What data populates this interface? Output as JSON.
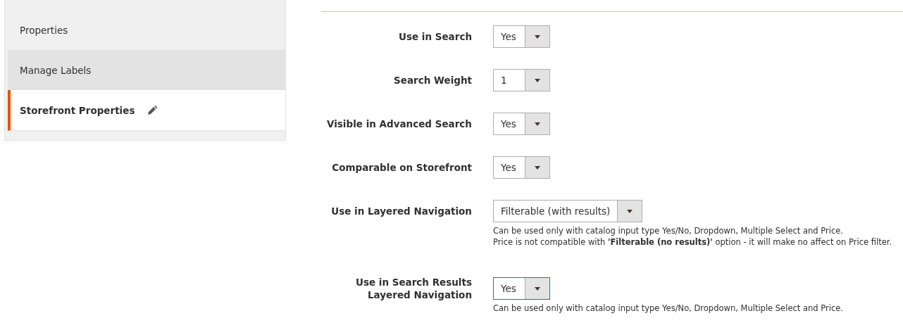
{
  "tabs": [
    {
      "label": "Properties",
      "selected": false,
      "hovered": false
    },
    {
      "label": "Manage Labels",
      "selected": false,
      "hovered": true
    },
    {
      "label": "Storefront Properties",
      "selected": true,
      "hovered": false,
      "edited": true
    }
  ],
  "fields": [
    {
      "label": "Use in Search",
      "value": "Yes",
      "focused": false
    },
    {
      "label": "Search Weight",
      "value": "1",
      "focused": false
    },
    {
      "label": "Visible in Advanced Search",
      "value": "Yes",
      "focused": false
    },
    {
      "label": "Comparable on Storefront",
      "value": "Yes",
      "focused": false
    },
    {
      "label": "Use in Layered Navigation",
      "value": "Filterable (with results)",
      "focused": false,
      "notes": [
        "Can be used only with catalog input type Yes/No, Dropdown, Multiple Select and Price.",
        "Price is not compatible with **'Filterable (no results)'** option - it will make no affect on Price filter."
      ]
    },
    {
      "label": "Use in Search Results Layered Navigation",
      "value": "Yes",
      "focused": true,
      "notes": [
        "Can be used only with catalog input type Yes/No, Dropdown, Multiple Select and Price."
      ]
    }
  ]
}
